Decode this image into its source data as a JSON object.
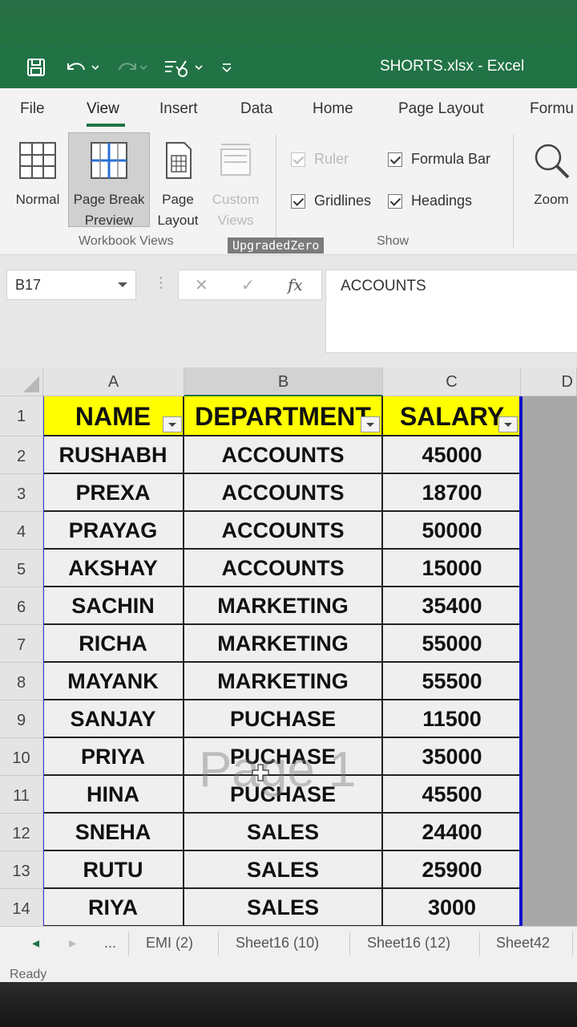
{
  "titlebar": {
    "title": "SHORTS.xlsx  -  Excel"
  },
  "menu_tabs": [
    {
      "label": "File"
    },
    {
      "label": "View"
    },
    {
      "label": "Insert"
    },
    {
      "label": "Data"
    },
    {
      "label": "Home"
    },
    {
      "label": "Page Layout"
    },
    {
      "label": "Formu"
    }
  ],
  "active_tab": "View",
  "ribbon": {
    "workbook_views": {
      "group_label": "Workbook Views",
      "normal": "Normal",
      "page_break_1": "Page Break",
      "page_break_2": "Preview",
      "page_layout_1": "Page",
      "page_layout_2": "Layout",
      "custom_1": "Custom",
      "custom_2": "Views"
    },
    "show": {
      "group_label": "Show",
      "ruler": "Ruler",
      "formula_bar": "Formula Bar",
      "gridlines": "Gridlines",
      "headings": "Headings"
    },
    "zoom": "Zoom"
  },
  "watermark": "UpgradedZero",
  "formula_bar": {
    "name_box": "B17",
    "fx": "fx",
    "content": "ACCOUNTS"
  },
  "columns": [
    "A",
    "B",
    "C",
    "D"
  ],
  "row_numbers": [
    "1",
    "2",
    "3",
    "4",
    "5",
    "6",
    "7",
    "8",
    "9",
    "10",
    "11",
    "12",
    "13",
    "14"
  ],
  "table": {
    "headers": [
      "NAME",
      "DEPARTMENT",
      "SALARY"
    ],
    "rows": [
      [
        "RUSHABH",
        "ACCOUNTS",
        "45000"
      ],
      [
        "PREXA",
        "ACCOUNTS",
        "18700"
      ],
      [
        "PRAYAG",
        "ACCOUNTS",
        "50000"
      ],
      [
        "AKSHAY",
        "ACCOUNTS",
        "15000"
      ],
      [
        "SACHIN",
        "MARKETING",
        "35400"
      ],
      [
        "RICHA",
        "MARKETING",
        "55000"
      ],
      [
        "MAYANK",
        "MARKETING",
        "55500"
      ],
      [
        "SANJAY",
        "PUCHASE",
        "11500"
      ],
      [
        "PRIYA",
        "PUCHASE",
        "35000"
      ],
      [
        "HINA",
        "PUCHASE",
        "45500"
      ],
      [
        "SNEHA",
        "SALES",
        "24400"
      ],
      [
        "RUTU",
        "SALES",
        "25900"
      ],
      [
        "RIYA",
        "SALES",
        "3000"
      ]
    ]
  },
  "page_label": "Page 1",
  "sheet_tabs": {
    "more": "...",
    "tabs": [
      "EMI (2)",
      "Sheet16 (10)",
      "Sheet16 (12)",
      "Sheet42"
    ]
  },
  "status": "Ready",
  "colors": {
    "excel_green": "#217346",
    "header_fill": "#ffff00",
    "page_break_line": "#1010c8"
  }
}
